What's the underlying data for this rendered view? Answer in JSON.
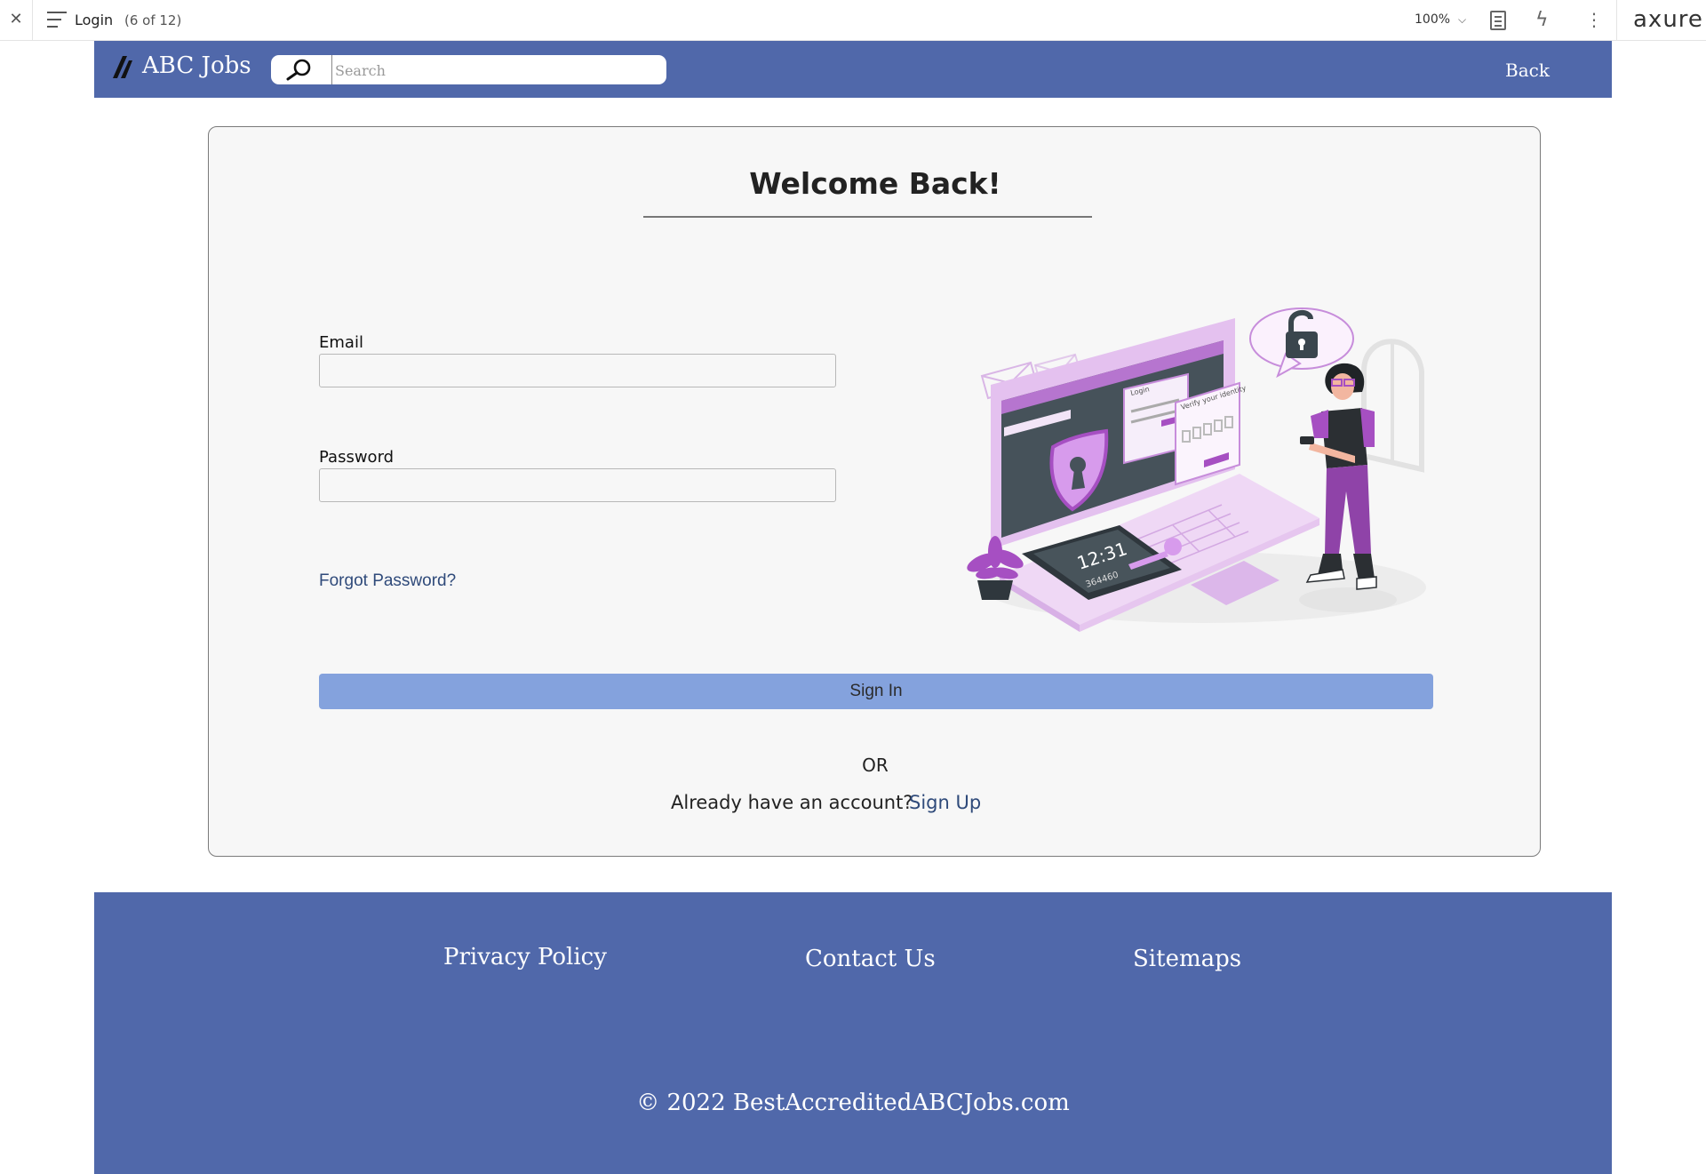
{
  "axure": {
    "close": "✕",
    "page_name": "Login",
    "page_count": "(6 of 12)",
    "zoom": "100%",
    "logo": "axure"
  },
  "header": {
    "brand": "ABC Jobs",
    "search_placeholder": "Search",
    "back_label": "Back"
  },
  "login": {
    "title": "Welcome Back!",
    "email_label": "Email",
    "email_value": "",
    "password_label": "Password",
    "password_value": "",
    "forgot_label": "Forgot Password?",
    "signin_label": "Sign In",
    "or_label": "OR",
    "already_text": "Already have an account?",
    "signup_label": "Sign Up",
    "illustration_icon": "login-security-illustration",
    "phone_time": "12:31",
    "phone_code": "364460",
    "illustration_text": [
      "Login",
      "Verify your identity"
    ]
  },
  "footer": {
    "privacy": "Privacy Policy",
    "contact": "Contact Us",
    "sitemaps": "Sitemaps",
    "copyright": "© 2022 BestAccreditedABCJobs.com"
  },
  "colors": {
    "header_bg": "#5068aa",
    "signin_bg": "#84a2dd",
    "link": "#2f4a7a",
    "illustration_accent": "#a64fc2"
  }
}
